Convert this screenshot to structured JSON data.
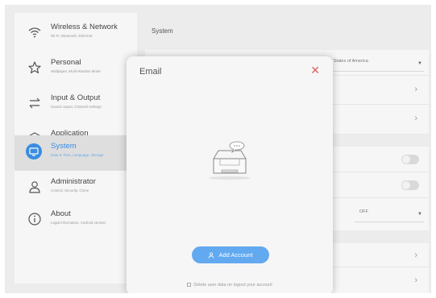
{
  "sidebar": {
    "items": [
      {
        "title": "Wireless & Network",
        "subtitle": "Wi-Fi, Bluetooth, Ethernet",
        "icon": "wifi-icon"
      },
      {
        "title": "Personal",
        "subtitle": "Wallpaper, Multi-Window Mode",
        "icon": "star-icon"
      },
      {
        "title": "Input & Output",
        "subtitle": "Sound output, Channel settings",
        "icon": "swap-arrows-icon"
      },
      {
        "title": "Application",
        "subtitle": "Application management",
        "icon": "shield-icon"
      },
      {
        "title": "System",
        "subtitle": "Date & Time, Language, Storage",
        "icon": "monitor-icon"
      },
      {
        "title": "Administrator",
        "subtitle": "Control, Security, Clone",
        "icon": "user-icon"
      },
      {
        "title": "About",
        "subtitle": "Legal information, Android version",
        "icon": "info-icon"
      }
    ],
    "active_index": 4
  },
  "main": {
    "section_title": "System",
    "country_value": "ed States of America",
    "off_value": "OFF"
  },
  "modal": {
    "title": "Email",
    "add_account_label": "Add Account",
    "delete_label": "Delete user data on logout your account"
  },
  "colors": {
    "accent": "#62a9ef",
    "active_text": "#3a8de0",
    "close": "#e06060"
  }
}
